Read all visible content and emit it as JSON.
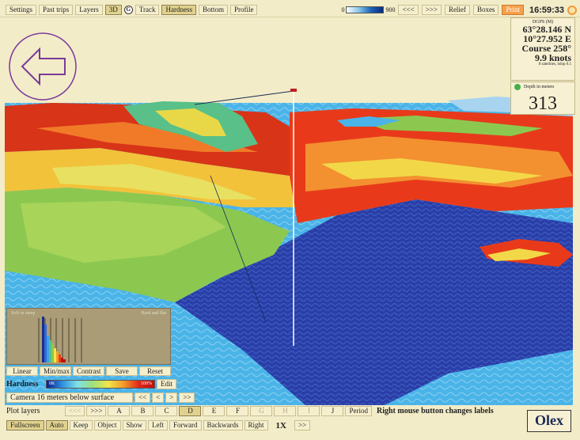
{
  "menu": [
    "Settings",
    "Past trips",
    "Layers",
    "3D",
    "Track",
    "Hardness",
    "Bottom",
    "Profile"
  ],
  "menu_icon": "circle-3d-toggle-icon",
  "depth_scale": {
    "min": "0",
    "max": "900"
  },
  "top_right": [
    "<<<",
    ">>>",
    "Relief",
    "Boxes",
    "Print"
  ],
  "clock": "16:59:33",
  "position": {
    "source": "DGPS (M)",
    "lat": "63°28.146 N",
    "lon": "10°27.952 E",
    "course": "Course 258°",
    "speed": "9.9 knots",
    "sats": "8 satellites, hdop 0.5"
  },
  "depth": {
    "label": "Depth in meters",
    "value": "313"
  },
  "histogram": {
    "left_label": "Soft or steep",
    "right_label": "Hard and flat"
  },
  "histogram_buttons": [
    "Linear",
    "Min/max",
    "Contrast",
    "Save",
    "Reset"
  ],
  "hardness": {
    "label": "Hardness",
    "min": "0K",
    "max": "100%",
    "edit": "Edit"
  },
  "camera": {
    "text": "Camera 16 meters below surface",
    "buttons": [
      "<<",
      "<",
      ">",
      ">>"
    ]
  },
  "plot_layers": {
    "label": "Plot layers",
    "prev": "<<<",
    "next": ">>>",
    "layers": [
      "A",
      "B",
      "C",
      "D",
      "E",
      "F",
      "G",
      "H",
      "I",
      "J"
    ],
    "active": "D",
    "period": "Period",
    "hint": "Right mouse button changes labels"
  },
  "bottom": {
    "buttons": [
      "Fullscreen",
      "Auto",
      "Keep",
      "Object",
      "Show",
      "Left",
      "Forward",
      "Backwards",
      "Right"
    ],
    "zoom": "1X",
    "zoom_button": ">>"
  },
  "logo": "Olex",
  "colors": {
    "panel": "#f3ecc8",
    "accent_print": "#f5a04c",
    "deep_blue": "#1b2f8c",
    "hard_red": "#e02818"
  }
}
